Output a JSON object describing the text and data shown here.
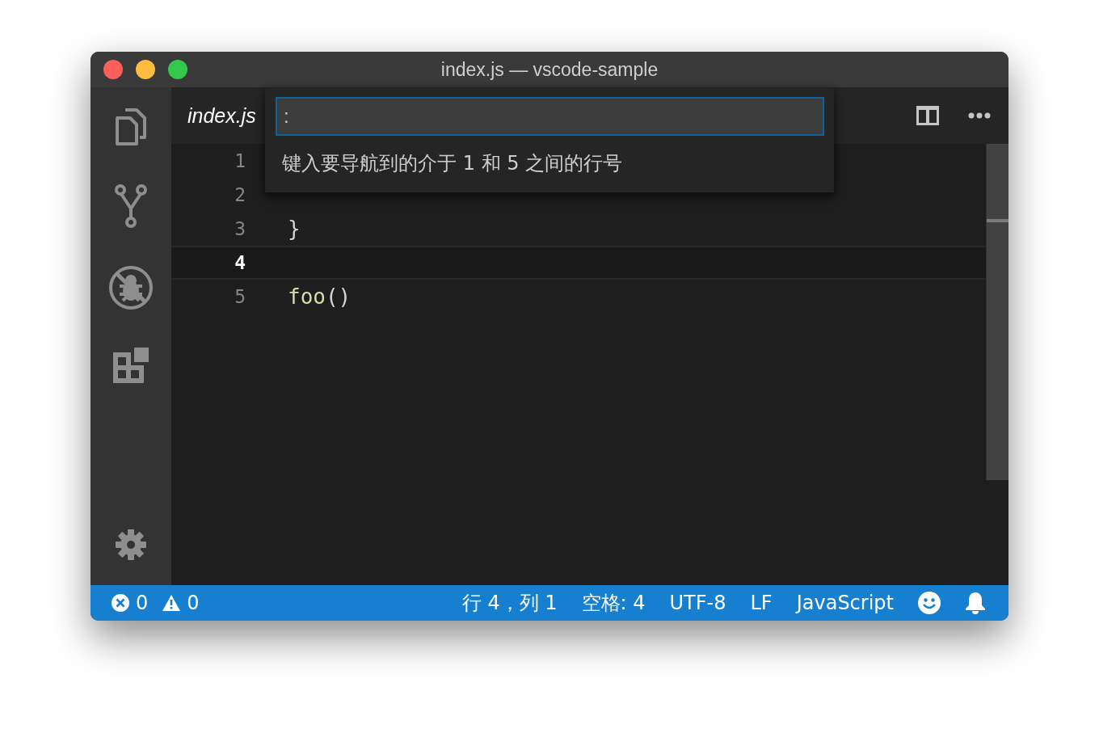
{
  "window": {
    "title": "index.js — vscode-sample"
  },
  "tab": {
    "label": "index.js"
  },
  "quick_open": {
    "value": ":",
    "hint": "键入要导航到的介于 1 和 5 之间的行号"
  },
  "lines": [
    {
      "number": "1",
      "current": false
    },
    {
      "number": "2",
      "current": false
    },
    {
      "number": "3",
      "current": false,
      "tokens": [
        {
          "kind": "punctuation",
          "text": "}"
        }
      ]
    },
    {
      "number": "4",
      "current": true
    },
    {
      "number": "5",
      "current": false,
      "tokens": [
        {
          "kind": "function",
          "text": "foo"
        },
        {
          "kind": "punctuation",
          "text": "()"
        }
      ]
    }
  ],
  "status_bar": {
    "errors": "0",
    "warnings": "0",
    "items": [
      "行 4，列 1",
      "空格: 4",
      "UTF-8",
      "LF",
      "JavaScript"
    ]
  }
}
